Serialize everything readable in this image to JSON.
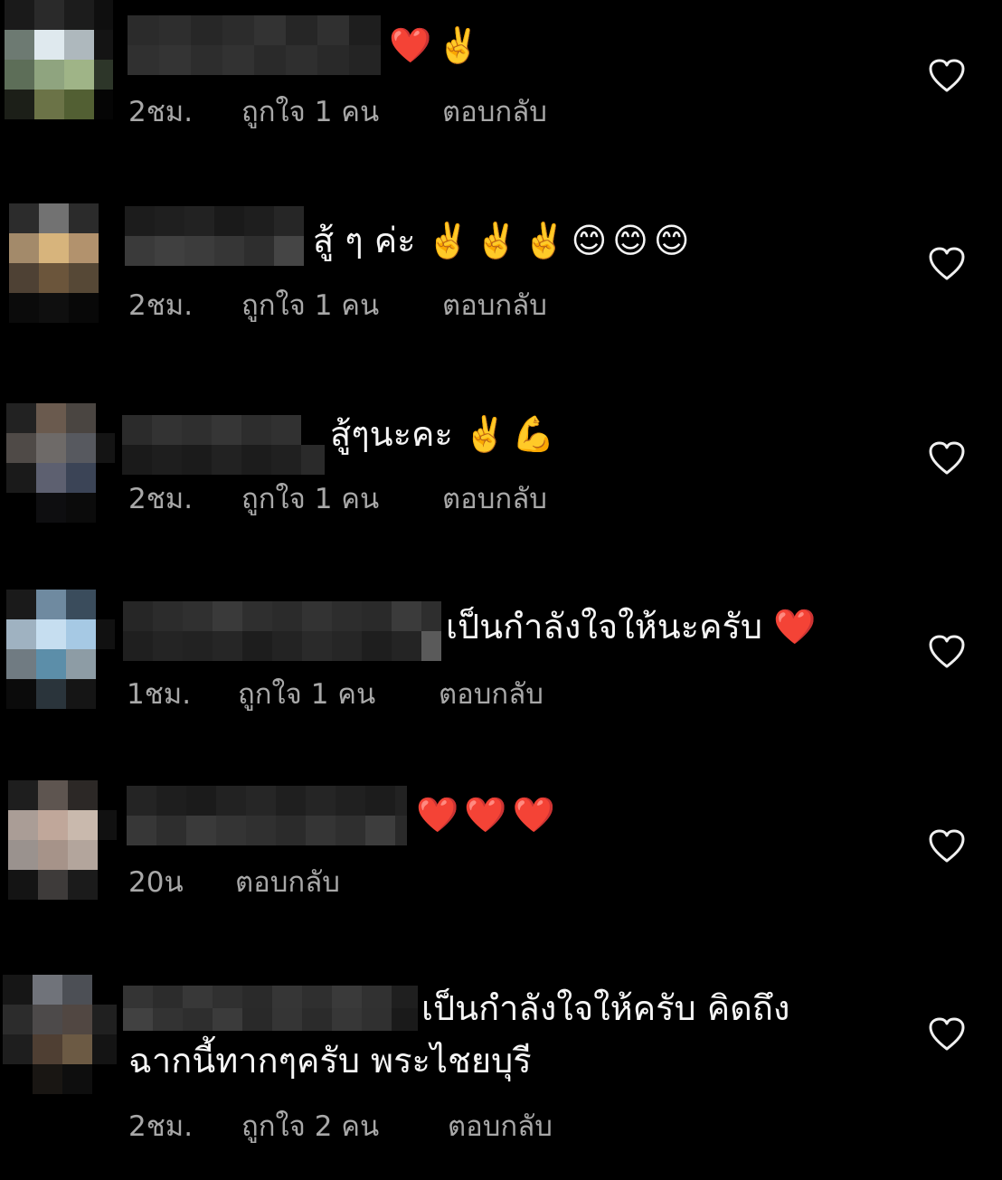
{
  "colors": {
    "background": "#000000",
    "text": "#f5f5f5",
    "meta": "#a8a8a8",
    "heart_outline": "#f0f0f0"
  },
  "comments": [
    {
      "text": "",
      "emoji": "❤️✌️",
      "time": "2ชม.",
      "likes": "ถูกใจ 1 คน",
      "reply": "ตอบกลับ",
      "like_icon": "heart-outline-icon"
    },
    {
      "text": "สู้ ๆ ค่ะ",
      "emoji": "✌️✌️✌️😊😊😊",
      "time": "2ชม.",
      "likes": "ถูกใจ 1 คน",
      "reply": "ตอบกลับ",
      "like_icon": "heart-outline-icon"
    },
    {
      "text": "สู้ๆนะคะ",
      "emoji": "✌️💪",
      "time": "2ชม.",
      "likes": "ถูกใจ 1 คน",
      "reply": "ตอบกลับ",
      "like_icon": "heart-outline-icon"
    },
    {
      "text": "เป็นกำลังใจให้นะครับ",
      "emoji": "❤️",
      "time": "1ชม.",
      "likes": "ถูกใจ 1 คน",
      "reply": "ตอบกลับ",
      "like_icon": "heart-outline-icon"
    },
    {
      "text": "",
      "emoji": "❤️❤️❤️",
      "time": "20น",
      "likes": "",
      "reply": "ตอบกลับ",
      "like_icon": "heart-outline-icon"
    },
    {
      "text": "เป็นกำลังใจให้ครับ คิดถึง",
      "text_line2": "ฉากนี้ทากๆครับ พระไชยบุรี",
      "emoji": "",
      "time": "2ชม.",
      "likes": "ถูกใจ 2 คน",
      "reply": "ตอบกลับ",
      "like_icon": "heart-outline-icon"
    }
  ]
}
